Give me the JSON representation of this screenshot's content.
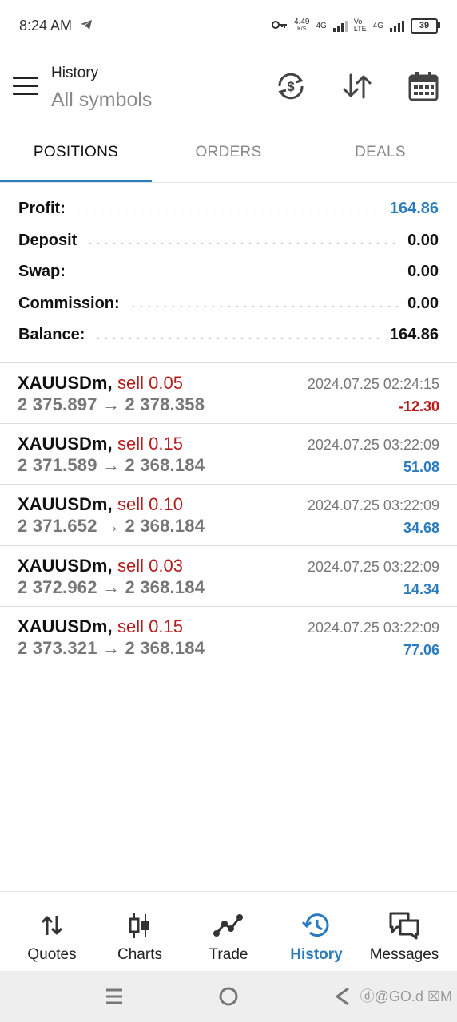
{
  "status_bar": {
    "time": "8:24 AM",
    "net_speed": "4.49",
    "net_unit": "K/S",
    "net1": "4G",
    "volte": "Vo\nLTE",
    "net2": "4G",
    "battery": "39"
  },
  "header": {
    "title": "History",
    "subtitle": "All symbols"
  },
  "tabs": [
    {
      "label": "POSITIONS",
      "active": true
    },
    {
      "label": "ORDERS",
      "active": false
    },
    {
      "label": "DEALS",
      "active": false
    }
  ],
  "summary": [
    {
      "label": "Profit:",
      "value": "164.86"
    },
    {
      "label": "Deposit",
      "value": "0.00"
    },
    {
      "label": "Swap:",
      "value": "0.00"
    },
    {
      "label": "Commission:",
      "value": "0.00"
    },
    {
      "label": "Balance:",
      "value": "164.86"
    }
  ],
  "deals": [
    {
      "symbol": "XAUUSDm,",
      "side": "sell 0.05",
      "prices": "2 375.897 → 2 378.358",
      "time": "2024.07.25 02:24:15",
      "profit": "-12.30"
    },
    {
      "symbol": "XAUUSDm,",
      "side": "sell 0.15",
      "prices": "2 371.589 → 2 368.184",
      "time": "2024.07.25 03:22:09",
      "profit": "51.08"
    },
    {
      "symbol": "XAUUSDm,",
      "side": "sell 0.10",
      "prices": "2 371.652 → 2 368.184",
      "time": "2024.07.25 03:22:09",
      "profit": "34.68"
    },
    {
      "symbol": "XAUUSDm,",
      "side": "sell 0.03",
      "prices": "2 372.962 → 2 368.184",
      "time": "2024.07.25 03:22:09",
      "profit": "14.34"
    },
    {
      "symbol": "XAUUSDm,",
      "side": "sell 0.15",
      "prices": "2 373.321 → 2 368.184",
      "time": "2024.07.25 03:22:09",
      "profit": "77.06"
    }
  ],
  "bottom_nav": [
    {
      "label": "Quotes",
      "icon": "quotes-icon"
    },
    {
      "label": "Charts",
      "icon": "charts-icon"
    },
    {
      "label": "Trade",
      "icon": "trade-icon"
    },
    {
      "label": "History",
      "icon": "history-icon",
      "active": true
    },
    {
      "label": "Messages",
      "icon": "messages-icon"
    }
  ],
  "watermark": "ⓓ@GO.d ☒M",
  "colors": {
    "accent": "#2b7bbf",
    "sell": "#b71c1c",
    "negative": "#b71c1c",
    "muted": "#8a8a8a"
  }
}
